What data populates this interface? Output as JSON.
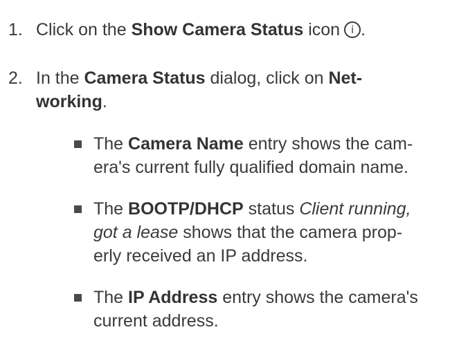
{
  "steps": [
    {
      "number": "1.",
      "pre": "Click on the ",
      "bold": "Show Camera Status",
      "post": " icon",
      "icon": "info-icon",
      "end": "."
    },
    {
      "number": "2.",
      "pre": "In the ",
      "bold1": "Camera Status",
      "mid": " dialog, click on ",
      "bold2a": "Net-",
      "bold2b": "working",
      "end": "."
    }
  ],
  "bullets": [
    {
      "pre": "The ",
      "bold": "Camera Name",
      "l1_post": " entry shows the cam-",
      "l2": "era's current fully qualified domain name."
    },
    {
      "pre": "The ",
      "bold": "BOOTP/DHCP",
      "l1_mid": " status ",
      "l1_italic": "Client running,",
      "l2_italic": "got a lease",
      "l2_post": " shows that the camera prop-",
      "l3": "erly received an IP address."
    },
    {
      "pre": "The ",
      "bold": "IP Address",
      "l1_post": " entry shows the camera's",
      "l2": "current address."
    }
  ]
}
